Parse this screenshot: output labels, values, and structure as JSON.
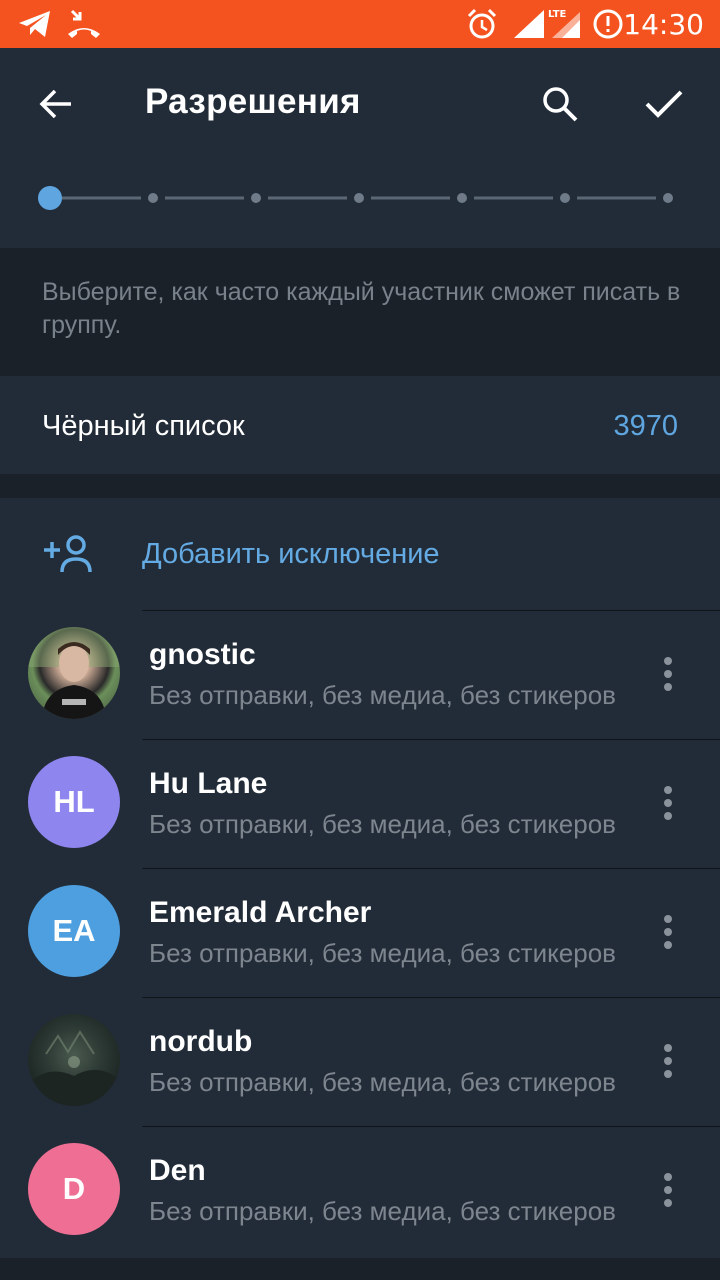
{
  "status_bar": {
    "time": "14:30",
    "network": "LTE",
    "icons": [
      "telegram-icon",
      "missed-call-icon",
      "alarm-icon",
      "signal-icon",
      "lte-signal-icon",
      "alert-icon"
    ]
  },
  "toolbar": {
    "title": "Разрешения",
    "icons": [
      "back-arrow-icon",
      "search-icon",
      "checkmark-icon"
    ]
  },
  "slow_mode": {
    "steps": 7,
    "selected_index": 0
  },
  "hint": {
    "text": "Выберите, как часто каждый участник сможет писать в группу."
  },
  "blacklist": {
    "label": "Чёрный список",
    "count": "3970"
  },
  "exceptions": {
    "add_label": "Добавить исключение",
    "users": [
      {
        "name": "gnostic",
        "status": "Без отправки, без медиа, без стикеров",
        "initials": "",
        "avatar_color": "#3b4a3a"
      },
      {
        "name": "Hu Lane",
        "status": "Без отправки, без медиа, без стикеров",
        "initials": "HL",
        "avatar_color": "#8e85ee"
      },
      {
        "name": "Emerald Archer",
        "status": "Без отправки, без медиа, без стикеров",
        "initials": "EA",
        "avatar_color": "#4d9fe0"
      },
      {
        "name": "nordub",
        "status": "Без отправки, без медиа, без стикеров",
        "initials": "",
        "avatar_color": "#2a3a3a"
      },
      {
        "name": "Den",
        "status": "Без отправки, без медиа, без стикеров",
        "initials": "D",
        "avatar_color": "#ee6f93"
      }
    ]
  },
  "colors": {
    "status_bar": "#f4531f",
    "header": "#222c38",
    "background": "#1a2129",
    "accent": "#5fa6e0"
  }
}
